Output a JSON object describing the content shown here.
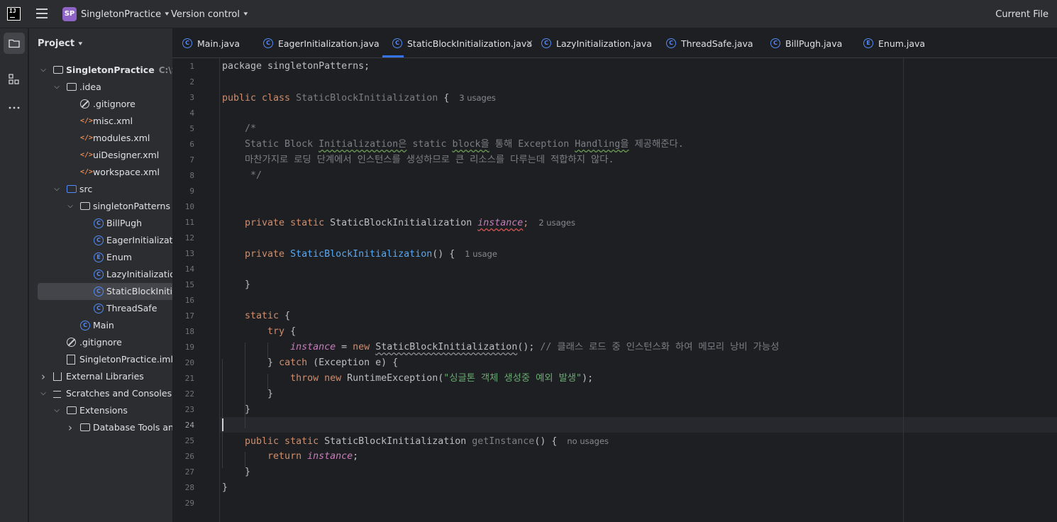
{
  "titlebar": {
    "logo_text": "IJ",
    "project_badge": "SP",
    "project_name": "SingletonPractice",
    "vcs_label": "Version control",
    "run_config_label": "Current File"
  },
  "project_panel": {
    "title": "Project",
    "tree": [
      {
        "label": "SingletonPractice",
        "extra": "C:\\Sing",
        "depth": 0,
        "arrow": "expanded",
        "icon": "module-folder-icon",
        "bold": true
      },
      {
        "label": ".idea",
        "depth": 1,
        "arrow": "expanded",
        "icon": "folder-icon"
      },
      {
        "label": ".gitignore",
        "depth": 2,
        "icon": "ignore-file-icon"
      },
      {
        "label": "misc.xml",
        "depth": 2,
        "icon": "xml-file-icon"
      },
      {
        "label": "modules.xml",
        "depth": 2,
        "icon": "xml-file-icon"
      },
      {
        "label": "uiDesigner.xml",
        "depth": 2,
        "icon": "xml-file-icon"
      },
      {
        "label": "workspace.xml",
        "depth": 2,
        "icon": "xml-file-icon"
      },
      {
        "label": "src",
        "depth": 1,
        "arrow": "expanded",
        "icon": "source-folder-icon"
      },
      {
        "label": "singletonPatterns",
        "depth": 2,
        "arrow": "expanded",
        "icon": "package-icon"
      },
      {
        "label": "BillPugh",
        "depth": 3,
        "icon": "class-icon"
      },
      {
        "label": "EagerInitialization",
        "depth": 3,
        "icon": "class-icon"
      },
      {
        "label": "Enum",
        "depth": 3,
        "icon": "enum-icon"
      },
      {
        "label": "LazyInitialization",
        "depth": 3,
        "icon": "class-icon"
      },
      {
        "label": "StaticBlockInitializ",
        "depth": 3,
        "icon": "class-icon",
        "selected": true
      },
      {
        "label": "ThreadSafe",
        "depth": 3,
        "icon": "class-icon"
      },
      {
        "label": "Main",
        "depth": 2,
        "icon": "main-class-icon"
      },
      {
        "label": ".gitignore",
        "depth": 1,
        "icon": "ignore-file-icon"
      },
      {
        "label": "SingletonPractice.iml",
        "depth": 1,
        "icon": "iml-file-icon"
      },
      {
        "label": "External Libraries",
        "depth": 0,
        "arrow": "collapsed",
        "icon": "library-icon"
      },
      {
        "label": "Scratches and Consoles",
        "depth": 0,
        "arrow": "expanded",
        "icon": "scratches-icon"
      },
      {
        "label": "Extensions",
        "depth": 1,
        "arrow": "expanded",
        "icon": "folder-icon"
      },
      {
        "label": "Database Tools and S",
        "depth": 2,
        "arrow": "collapsed",
        "icon": "folder-icon"
      }
    ]
  },
  "tabs": [
    {
      "label": "Main.java",
      "icon": "main-class-icon",
      "glyph": "C"
    },
    {
      "label": "EagerInitialization.java",
      "icon": "class-icon",
      "glyph": "C"
    },
    {
      "label": "StaticBlockInitialization.java",
      "icon": "class-icon",
      "glyph": "C",
      "active": true,
      "close": "×"
    },
    {
      "label": "LazyInitialization.java",
      "icon": "class-icon",
      "glyph": "C"
    },
    {
      "label": "ThreadSafe.java",
      "icon": "class-icon",
      "glyph": "C"
    },
    {
      "label": "BillPugh.java",
      "icon": "class-icon",
      "glyph": "C"
    },
    {
      "label": "Enum.java",
      "icon": "enum-icon",
      "glyph": "E"
    }
  ],
  "editor": {
    "current_line": 24,
    "line_numbers": [
      "1",
      "2",
      "3",
      "4",
      "5",
      "6",
      "7",
      "8",
      "9",
      "10",
      "11",
      "12",
      "13",
      "14",
      "15",
      "16",
      "17",
      "18",
      "19",
      "20",
      "21",
      "22",
      "23",
      "24",
      "25",
      "26",
      "27",
      "28",
      "29"
    ],
    "lines": [
      [
        {
          "t": "package singletonPatterns;",
          "c": ""
        }
      ],
      [],
      [
        {
          "t": "public class ",
          "c": "kw"
        },
        {
          "t": "StaticBlockInitialization",
          "c": "decl"
        },
        {
          "t": " {",
          "c": ""
        },
        {
          "t": "3 usages",
          "c": "hint"
        }
      ],
      [],
      [
        {
          "t": "    /*",
          "c": "cm"
        }
      ],
      [
        {
          "t": "    Static Block ",
          "c": "cm"
        },
        {
          "t": "Initialization은",
          "c": "cm squig"
        },
        {
          "t": " static ",
          "c": "cm"
        },
        {
          "t": "block을",
          "c": "cm squig"
        },
        {
          "t": " 통해 Exception ",
          "c": "cm"
        },
        {
          "t": "Handling을",
          "c": "cm squig"
        },
        {
          "t": " 제공해준다.",
          "c": "cm"
        }
      ],
      [
        {
          "t": "    마찬가지로 로딩 단계에서 인스턴스를 생성하므로 큰 리소스를 다루는데 적합하지 않다.",
          "c": "cm"
        }
      ],
      [
        {
          "t": "     */",
          "c": "cm"
        }
      ],
      [],
      [],
      [
        {
          "t": "    private static ",
          "c": "kw"
        },
        {
          "t": "StaticBlockInitialization ",
          "c": ""
        },
        {
          "t": "instance",
          "c": "fld squig-red"
        },
        {
          "t": ";",
          "c": "kw"
        },
        {
          "t": "2 usages",
          "c": "hint"
        }
      ],
      [],
      [
        {
          "t": "    private ",
          "c": "kw"
        },
        {
          "t": "StaticBlockInitialization",
          "c": "fn"
        },
        {
          "t": "() {",
          "c": ""
        },
        {
          "t": "1 usage",
          "c": "hint"
        }
      ],
      [],
      [
        {
          "t": "    }",
          "c": ""
        }
      ],
      [],
      [
        {
          "t": "    static ",
          "c": "kw"
        },
        {
          "t": "{",
          "c": ""
        }
      ],
      [
        {
          "t": "        try ",
          "c": "kw"
        },
        {
          "t": "{",
          "c": ""
        }
      ],
      [
        {
          "t": "            ",
          "c": ""
        },
        {
          "t": "instance",
          "c": "fld"
        },
        {
          "t": " = ",
          "c": ""
        },
        {
          "t": "new ",
          "c": "kw"
        },
        {
          "t": "StaticBlockInitialization",
          "c": "squig-dim"
        },
        {
          "t": "(); ",
          "c": ""
        },
        {
          "t": "// 클래스 로드 중 인스턴스화 하여 메모리 낭비 가능성",
          "c": "cm"
        }
      ],
      [
        {
          "t": "        } ",
          "c": ""
        },
        {
          "t": "catch ",
          "c": "kw"
        },
        {
          "t": "(Exception e) {",
          "c": ""
        }
      ],
      [
        {
          "t": "            throw new ",
          "c": "kw"
        },
        {
          "t": "RuntimeException(",
          "c": ""
        },
        {
          "t": "\"싱글톤 객체 생성중 예외 발생\"",
          "c": "str"
        },
        {
          "t": ");",
          "c": ""
        }
      ],
      [
        {
          "t": "        }",
          "c": ""
        }
      ],
      [
        {
          "t": "    }",
          "c": ""
        }
      ],
      [],
      [
        {
          "t": "    public static ",
          "c": "kw"
        },
        {
          "t": "StaticBlockInitialization ",
          "c": ""
        },
        {
          "t": "getInstance",
          "c": "decl"
        },
        {
          "t": "() {",
          "c": ""
        },
        {
          "t": "no usages",
          "c": "hint"
        }
      ],
      [
        {
          "t": "        return ",
          "c": "kw"
        },
        {
          "t": "instance",
          "c": "fld"
        },
        {
          "t": ";",
          "c": ""
        }
      ],
      [
        {
          "t": "    }",
          "c": ""
        }
      ],
      [
        {
          "t": "}",
          "c": ""
        }
      ],
      []
    ]
  },
  "colors": {
    "accent": "#3574f0",
    "keyword": "#cf8e6d",
    "comment": "#7a7e85",
    "field": "#c77dbb",
    "method": "#56a8f5",
    "string": "#6aab73",
    "class_icon": "#548af7",
    "xml_icon": "#e08855"
  }
}
